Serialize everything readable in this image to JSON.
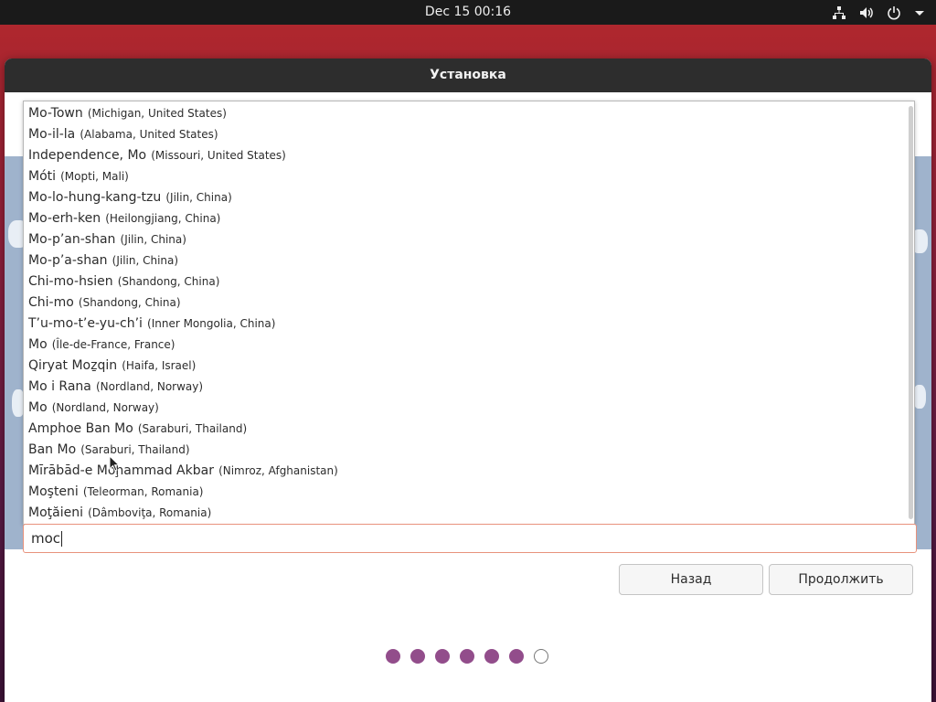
{
  "topbar": {
    "clock": "Dec 15  00:16",
    "icons": [
      "network-icon",
      "volume-icon",
      "power-icon",
      "menu-arrow-icon"
    ]
  },
  "window": {
    "title": "Установка"
  },
  "suggestions": [
    {
      "name": "Mo-Town",
      "region": "(Michigan, United States)"
    },
    {
      "name": "Mo-il-la",
      "region": "(Alabama, United States)"
    },
    {
      "name": "Independence, Mo",
      "region": "(Missouri, United States)"
    },
    {
      "name": "Móti",
      "region": "(Mopti, Mali)"
    },
    {
      "name": "Mo-lo-hung-kang-tzu",
      "region": "(Jilin, China)"
    },
    {
      "name": "Mo-erh-ken",
      "region": "(Heilongjiang, China)"
    },
    {
      "name": "Mo-p’an-shan",
      "region": "(Jilin, China)"
    },
    {
      "name": "Mo-p’a-shan",
      "region": "(Jilin, China)"
    },
    {
      "name": "Chi-mo-hsien",
      "region": "(Shandong, China)"
    },
    {
      "name": "Chi-mo",
      "region": "(Shandong, China)"
    },
    {
      "name": "T’u-mo-t’e-yu-ch’i",
      "region": "(Inner Mongolia, China)"
    },
    {
      "name": "Mo",
      "region": "(Île-de-France, France)"
    },
    {
      "name": "Qiryat Moẕqin",
      "region": "(Haifa, Israel)"
    },
    {
      "name": "Mo i Rana",
      "region": "(Nordland, Norway)"
    },
    {
      "name": "Mo",
      "region": "(Nordland, Norway)"
    },
    {
      "name": "Amphoe Ban Mo",
      "region": "(Saraburi, Thailand)"
    },
    {
      "name": "Ban Mo",
      "region": "(Saraburi, Thailand)"
    },
    {
      "name": "Mīrābād-e Moḩammad Akbar",
      "region": "(Nimroz, Afghanistan)"
    },
    {
      "name": "Moşteni",
      "region": "(Teleorman, Romania)"
    },
    {
      "name": "Moţăieni",
      "region": "(Dâmboviţa, Romania)"
    }
  ],
  "search": {
    "value": "moc"
  },
  "buttons": {
    "back": "Назад",
    "continue": "Продолжить"
  },
  "progress": {
    "completed": 6,
    "total": 7
  },
  "colors": {
    "accent": "#924d8b",
    "input_focus": "#e8927c",
    "panel": "#1a1a1a"
  }
}
